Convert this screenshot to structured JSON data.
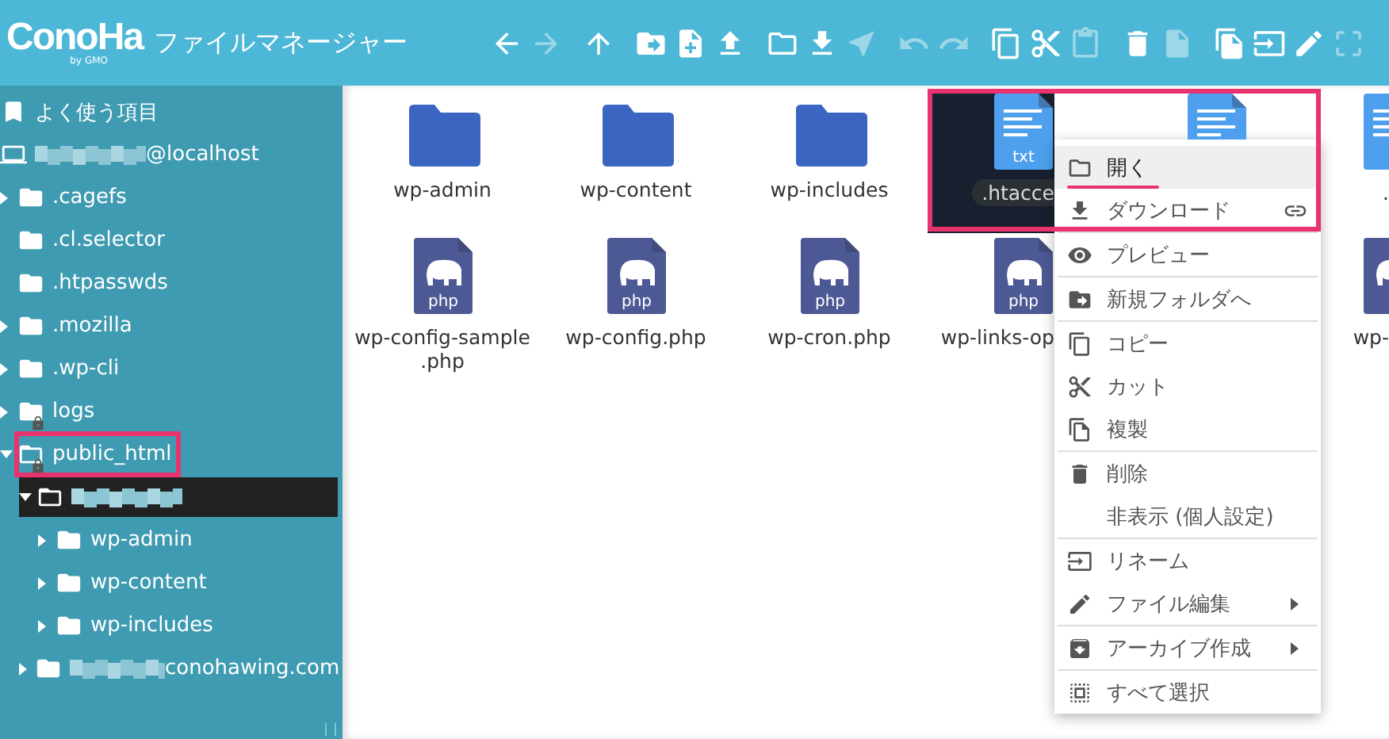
{
  "header": {
    "logo": "ConoHa",
    "logo_sub": "by GMO",
    "title": "ファイルマネージャー"
  },
  "toolbar": [
    [
      {
        "disabled": false
      },
      {
        "disabled": true
      }
    ],
    [
      {
        "disabled": false
      }
    ],
    [
      {
        "disabled": false
      },
      {
        "disabled": false
      },
      {
        "disabled": false
      }
    ],
    [
      {
        "disabled": false
      },
      {
        "disabled": false
      },
      {
        "disabled": true
      }
    ],
    [
      {
        "disabled": true
      },
      {
        "disabled": true
      }
    ],
    [
      {
        "disabled": false
      },
      {
        "disabled": false
      },
      {
        "disabled": true
      }
    ],
    [
      {
        "disabled": false
      },
      {
        "disabled": true
      }
    ],
    [
      {
        "disabled": false
      },
      {
        "disabled": false
      },
      {
        "disabled": false
      },
      {
        "disabled": true
      }
    ]
  ],
  "sidebar": {
    "favorites": {
      "label": "よく使う項目"
    },
    "tree": [
      {
        "label": "@localhost",
        "redacted": true,
        "selected": false,
        "children": [
          {
            "label": ".cagefs",
            "selected": false,
            "expanded": false,
            "has_children": true
          },
          {
            "label": ".cl.selector",
            "selected": false,
            "expanded": false,
            "has_children": false
          },
          {
            "label": ".htpasswds",
            "selected": false,
            "expanded": false,
            "has_children": false
          },
          {
            "label": ".mozilla",
            "selected": false,
            "expanded": false,
            "has_children": true
          },
          {
            "label": ".wp-cli",
            "selected": false,
            "expanded": false,
            "has_children": true
          },
          {
            "label": "logs",
            "selected": false,
            "expanded": false,
            "has_children": true,
            "locked": true
          },
          {
            "label": "public_html",
            "selected": false,
            "expanded": true,
            "has_children": true,
            "locked": true,
            "highlighted": true,
            "children": [
              {
                "redacted": true,
                "selected": true,
                "expanded": true,
                "has_children": true,
                "children": [
                  {
                    "label": "wp-admin",
                    "selected": false,
                    "expanded": false,
                    "has_children": true
                  },
                  {
                    "label": "wp-content",
                    "selected": false,
                    "expanded": false,
                    "has_children": true
                  },
                  {
                    "label": "wp-includes",
                    "selected": false,
                    "expanded": false,
                    "has_children": true
                  }
                ]
              },
              {
                "label": "conohawing.com",
                "redacted": true,
                "selected": false,
                "expanded": false,
                "has_children": true
              }
            ]
          }
        ]
      }
    ]
  },
  "file_columns": [
    [
      {
        "kind": "folder",
        "label": "wp-admin",
        "selected": false
      },
      {
        "kind": "php",
        "badge": "php",
        "label": "wp-config-sample\n.php",
        "selected": false
      }
    ],
    [
      {
        "kind": "folder",
        "label": "wp-content",
        "selected": false
      },
      {
        "kind": "php",
        "badge": "php",
        "label": "wp-config.php",
        "selected": false
      }
    ],
    [
      {
        "kind": "folder",
        "label": "wp-includes",
        "selected": false
      },
      {
        "kind": "php",
        "badge": "php",
        "label": "wp-cron.php",
        "selected": false
      }
    ],
    [
      {
        "kind": "txt",
        "badge": "txt",
        "label": ".htacce",
        "selected": true
      },
      {
        "kind": "php",
        "badge": "php",
        "label": "wp-links-op",
        "selected": false
      }
    ],
    [
      {
        "kind": "txt",
        "selected": false
      }
    ],
    [
      {
        "kind": "txt",
        "label": ".",
        "selected": false
      },
      {
        "kind": "php",
        "label": "wp-",
        "selected": false
      }
    ]
  ],
  "context_menu": {
    "highlighted": true,
    "items": [
      {
        "kind": "item",
        "label": "開く",
        "selected": true,
        "underlined": true
      },
      {
        "kind": "item",
        "label": "ダウンロード",
        "selected": false,
        "link": true
      },
      {
        "kind": "separator"
      },
      {
        "kind": "item",
        "label": "プレビュー",
        "selected": false
      },
      {
        "kind": "separator"
      },
      {
        "kind": "item",
        "label": "新規フォルダへ",
        "selected": false
      },
      {
        "kind": "separator"
      },
      {
        "kind": "item",
        "label": "コピー",
        "selected": false
      },
      {
        "kind": "item",
        "label": "カット",
        "selected": false
      },
      {
        "kind": "item",
        "label": "複製",
        "selected": false
      },
      {
        "kind": "separator"
      },
      {
        "kind": "item",
        "label": "削除",
        "selected": false
      },
      {
        "kind": "item",
        "label": "非表示 (個人設定)",
        "selected": false
      },
      {
        "kind": "separator"
      },
      {
        "kind": "item",
        "label": "リネーム",
        "selected": false
      },
      {
        "kind": "item",
        "label": "ファイル編集",
        "selected": false,
        "submenu": true
      },
      {
        "kind": "separator"
      },
      {
        "kind": "item",
        "label": "アーカイブ作成",
        "selected": false,
        "submenu": true
      },
      {
        "kind": "separator"
      },
      {
        "kind": "item",
        "label": "すべて選択",
        "selected": false
      }
    ]
  }
}
